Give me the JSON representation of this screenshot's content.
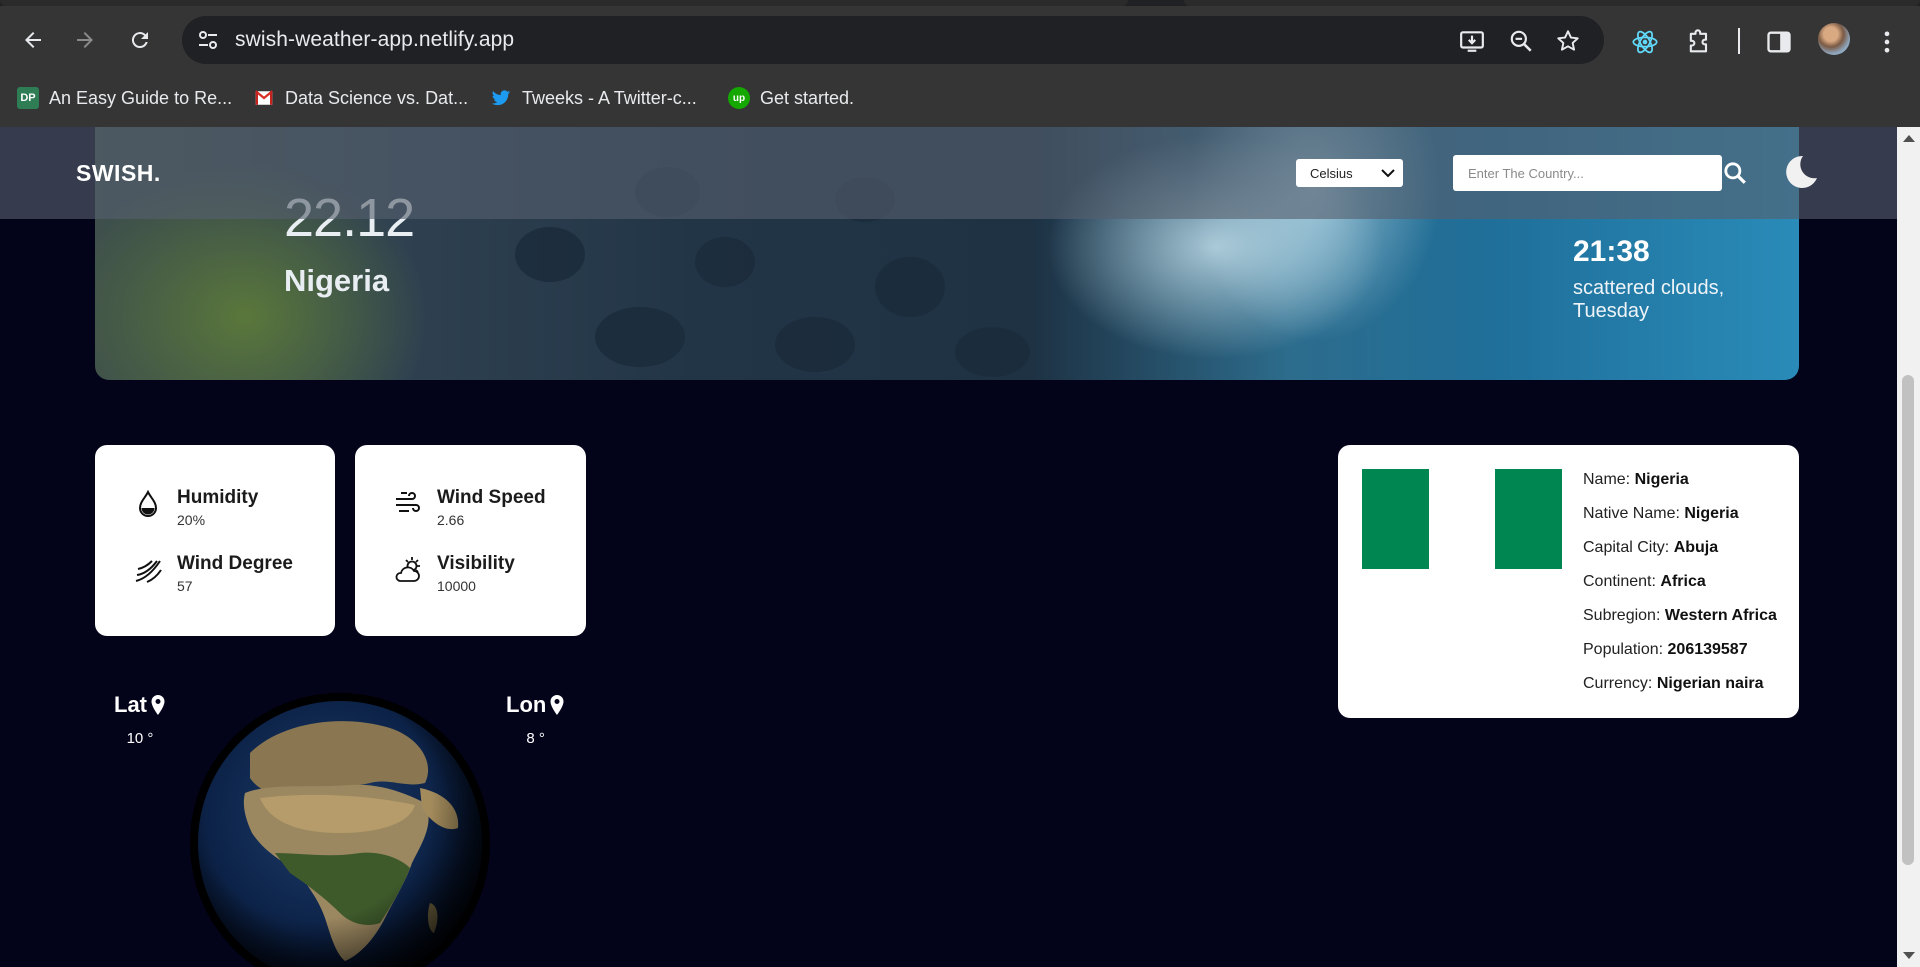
{
  "browser": {
    "url": "swish-weather-app.netlify.app",
    "bookmarks": [
      {
        "label": "An Easy Guide to Re...",
        "icon": "dp-icon"
      },
      {
        "label": "Data Science vs. Dat...",
        "icon": "gmail-icon"
      },
      {
        "label": "Tweeks - A Twitter-c...",
        "icon": "twitter-icon"
      },
      {
        "label": "Get started.",
        "icon": "upwork-icon"
      }
    ],
    "icons": [
      "back-icon",
      "forward-icon",
      "reload-icon",
      "site-info-icon",
      "install-app-icon",
      "zoom-icon",
      "star-icon",
      "react-devtools-icon",
      "extensions-icon",
      "side-panel-icon",
      "profile-avatar",
      "menu-icon"
    ]
  },
  "header": {
    "brand": "SWISH.",
    "unit_selected": "Celsius",
    "search_placeholder": "Enter The Country..."
  },
  "hero": {
    "temperature": "22.12",
    "country": "Nigeria",
    "time": "21:38",
    "description": "scattered clouds, Tuesday"
  },
  "stats": {
    "humidity": {
      "label": "Humidity",
      "value": "20%"
    },
    "wind_degree": {
      "label": "Wind Degree",
      "value": "57"
    },
    "wind_speed": {
      "label": "Wind Speed",
      "value": "2.66"
    },
    "visibility": {
      "label": "Visibility",
      "value": "10000"
    }
  },
  "coords": {
    "lat_label": "Lat",
    "lat_value": "10 °",
    "lon_label": "Lon",
    "lon_value": "8 °"
  },
  "country_info": {
    "flag_colors": [
      "#008751",
      "#ffffff",
      "#008751"
    ],
    "rows": [
      {
        "label": "Name:",
        "value": "Nigeria"
      },
      {
        "label": "Native Name:",
        "value": "Nigeria"
      },
      {
        "label": "Capital City:",
        "value": "Abuja"
      },
      {
        "label": "Continent:",
        "value": "Africa"
      },
      {
        "label": "Subregion:",
        "value": "Western Africa"
      },
      {
        "label": "Population:",
        "value": "206139587"
      },
      {
        "label": "Currency:",
        "value": "Nigerian naira"
      }
    ]
  },
  "colors": {
    "page_background": "#03031a",
    "card_background": "#ffffff",
    "flag_green": "#008751"
  }
}
